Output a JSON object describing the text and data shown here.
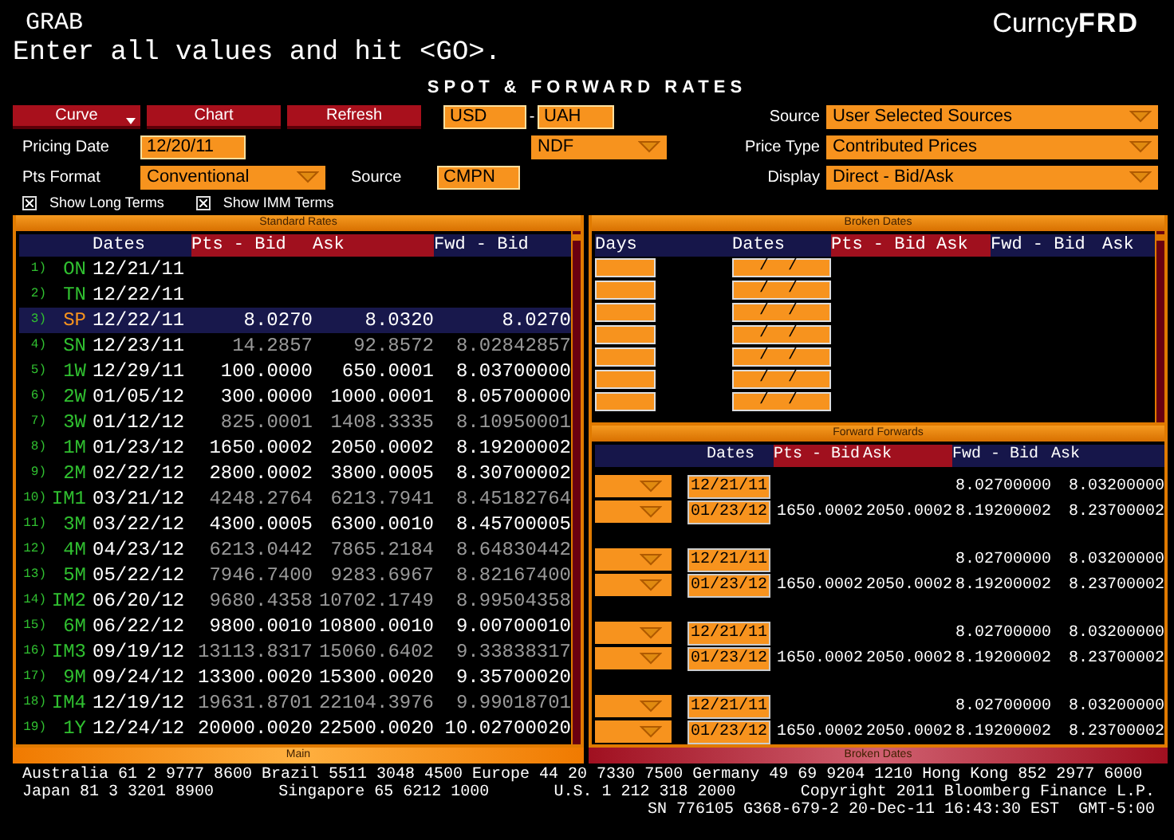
{
  "header": {
    "screen_name": "GRAB",
    "prompt": "Enter all values and hit <GO>.",
    "logo_prefix": "Curncy",
    "logo_suffix": "FRD"
  },
  "page_title": "SPOT & FORWARD RATES",
  "buttons": [
    {
      "label": "Curve",
      "has_menu": true
    },
    {
      "label": "Chart",
      "has_menu": false
    },
    {
      "label": "Refresh",
      "has_menu": false
    }
  ],
  "currency_pair": {
    "base": "USD",
    "separator": "-",
    "quote": "UAH"
  },
  "pricing_date": {
    "label": "Pricing Date",
    "value": "12/20/11"
  },
  "contract_type": {
    "value": "NDF"
  },
  "pts_format": {
    "label": "Pts Format",
    "value": "Conventional"
  },
  "rate_source": {
    "label": "Source",
    "value": "CMPN"
  },
  "settings": [
    {
      "label": "Source",
      "value": "User Selected Sources"
    },
    {
      "label": "Price Type",
      "value": "Contributed Prices"
    },
    {
      "label": "Display",
      "value": "Direct - Bid/Ask"
    }
  ],
  "options": [
    {
      "label": "Show Long Terms",
      "checked": true
    },
    {
      "label": "Show IMM Terms",
      "checked": true
    }
  ],
  "standard_rates": {
    "title": "Standard Rates",
    "columns": [
      {
        "label": "Dates",
        "kind": "dates"
      },
      {
        "label": "Pts - Bid",
        "kind": "points"
      },
      {
        "label": "Ask",
        "kind": "points"
      },
      {
        "label": "Fwd - Bid",
        "kind": "forward"
      }
    ],
    "rows": [
      {
        "number": "1)",
        "tenor": "ON",
        "date": "12/21/11",
        "selected": false
      },
      {
        "number": "2)",
        "tenor": "TN",
        "date": "12/22/11",
        "selected": false
      },
      {
        "number": "3)",
        "tenor": "SP",
        "date": "12/22/11",
        "pts_bid": "8.0270",
        "pts_ask": "8.0320",
        "fwd_bid": "8.0270",
        "selected": true,
        "interpolated": false
      },
      {
        "number": "4)",
        "tenor": "SN",
        "date": "12/23/11",
        "pts_bid": "14.2857",
        "pts_ask": "92.8572",
        "fwd_bid": "8.02842857",
        "selected": false,
        "interpolated": true
      },
      {
        "number": "5)",
        "tenor": "1W",
        "date": "12/29/11",
        "pts_bid": "100.0000",
        "pts_ask": "650.0001",
        "fwd_bid": "8.03700000",
        "selected": false,
        "interpolated": false
      },
      {
        "number": "6)",
        "tenor": "2W",
        "date": "01/05/12",
        "pts_bid": "300.0000",
        "pts_ask": "1000.0001",
        "fwd_bid": "8.05700000",
        "selected": false,
        "interpolated": false
      },
      {
        "number": "7)",
        "tenor": "3W",
        "date": "01/12/12",
        "pts_bid": "825.0001",
        "pts_ask": "1408.3335",
        "fwd_bid": "8.10950001",
        "selected": false,
        "interpolated": true
      },
      {
        "number": "8)",
        "tenor": "1M",
        "date": "01/23/12",
        "pts_bid": "1650.0002",
        "pts_ask": "2050.0002",
        "fwd_bid": "8.19200002",
        "selected": false,
        "interpolated": false
      },
      {
        "number": "9)",
        "tenor": "2M",
        "date": "02/22/12",
        "pts_bid": "2800.0002",
        "pts_ask": "3800.0005",
        "fwd_bid": "8.30700002",
        "selected": false,
        "interpolated": false
      },
      {
        "number": "10)",
        "tenor": "IM1",
        "date": "03/21/12",
        "pts_bid": "4248.2764",
        "pts_ask": "6213.7941",
        "fwd_bid": "8.45182764",
        "selected": false,
        "interpolated": true
      },
      {
        "number": "11)",
        "tenor": "3M",
        "date": "03/22/12",
        "pts_bid": "4300.0005",
        "pts_ask": "6300.0010",
        "fwd_bid": "8.45700005",
        "selected": false,
        "interpolated": false
      },
      {
        "number": "12)",
        "tenor": "4M",
        "date": "04/23/12",
        "pts_bid": "6213.0442",
        "pts_ask": "7865.2184",
        "fwd_bid": "8.64830442",
        "selected": false,
        "interpolated": true
      },
      {
        "number": "13)",
        "tenor": "5M",
        "date": "05/22/12",
        "pts_bid": "7946.7400",
        "pts_ask": "9283.6967",
        "fwd_bid": "8.82167400",
        "selected": false,
        "interpolated": true
      },
      {
        "number": "14)",
        "tenor": "IM2",
        "date": "06/20/12",
        "pts_bid": "9680.4358",
        "pts_ask": "10702.1749",
        "fwd_bid": "8.99504358",
        "selected": false,
        "interpolated": true
      },
      {
        "number": "15)",
        "tenor": "6M",
        "date": "06/22/12",
        "pts_bid": "9800.0010",
        "pts_ask": "10800.0010",
        "fwd_bid": "9.00700010",
        "selected": false,
        "interpolated": false
      },
      {
        "number": "16)",
        "tenor": "IM3",
        "date": "09/19/12",
        "pts_bid": "13113.8317",
        "pts_ask": "15060.6402",
        "fwd_bid": "9.33838317",
        "selected": false,
        "interpolated": true
      },
      {
        "number": "17)",
        "tenor": "9M",
        "date": "09/24/12",
        "pts_bid": "13300.0020",
        "pts_ask": "15300.0020",
        "fwd_bid": "9.35700020",
        "selected": false,
        "interpolated": false
      },
      {
        "number": "18)",
        "tenor": "IM4",
        "date": "12/19/12",
        "pts_bid": "19631.8701",
        "pts_ask": "22104.3976",
        "fwd_bid": "9.99018701",
        "selected": false,
        "interpolated": true
      },
      {
        "number": "19)",
        "tenor": "1Y",
        "date": "12/24/12",
        "pts_bid": "20000.0020",
        "pts_ask": "22500.0020",
        "fwd_bid": "10.02700020",
        "selected": false,
        "interpolated": false
      }
    ]
  },
  "broken_dates": {
    "title": "Broken Dates",
    "columns": [
      {
        "label": "Days",
        "kind": "dates"
      },
      {
        "label": "Dates",
        "kind": "dates"
      },
      {
        "label": "Pts - Bid",
        "kind": "points"
      },
      {
        "label": "Ask",
        "kind": "points"
      },
      {
        "label": "Fwd - Bid",
        "kind": "forward"
      },
      {
        "label": "Ask",
        "kind": "forward"
      }
    ],
    "rows": [
      {
        "date": "/  /"
      },
      {
        "date": "/  /"
      },
      {
        "date": "/  /"
      },
      {
        "date": "/  /"
      },
      {
        "date": "/  /"
      },
      {
        "date": "/  /"
      },
      {
        "date": "/  /"
      }
    ]
  },
  "forward_forwards": {
    "title": "Forward Forwards",
    "columns": [
      {
        "label": "Dates",
        "kind": "dates"
      },
      {
        "label": "Pts - Bid",
        "kind": "points"
      },
      {
        "label": "Ask",
        "kind": "points"
      },
      {
        "label": "Fwd - Bid",
        "kind": "forward"
      },
      {
        "label": "Ask",
        "kind": "forward"
      }
    ],
    "pairs": [
      {
        "legs": [
          {
            "date": "12/21/11",
            "fwd_bid": "8.02700000",
            "fwd_ask": "8.03200000"
          },
          {
            "date": "01/23/12",
            "pts_bid": "1650.0002",
            "pts_ask": "2050.0002",
            "fwd_bid": "8.19200002",
            "fwd_ask": "8.23700002"
          }
        ]
      },
      {
        "legs": [
          {
            "date": "12/21/11",
            "fwd_bid": "8.02700000",
            "fwd_ask": "8.03200000"
          },
          {
            "date": "01/23/12",
            "pts_bid": "1650.0002",
            "pts_ask": "2050.0002",
            "fwd_bid": "8.19200002",
            "fwd_ask": "8.23700002"
          }
        ]
      },
      {
        "legs": [
          {
            "date": "12/21/11",
            "fwd_bid": "8.02700000",
            "fwd_ask": "8.03200000"
          },
          {
            "date": "01/23/12",
            "pts_bid": "1650.0002",
            "pts_ask": "2050.0002",
            "fwd_bid": "8.19200002",
            "fwd_ask": "8.23700002"
          }
        ]
      },
      {
        "legs": [
          {
            "date": "12/21/11",
            "fwd_bid": "8.02700000",
            "fwd_ask": "8.03200000"
          },
          {
            "date": "01/23/12",
            "pts_bid": "1650.0002",
            "pts_ask": "2050.0002",
            "fwd_bid": "8.19200002",
            "fwd_ask": "8.23700002"
          }
        ]
      }
    ]
  },
  "tabs": [
    {
      "label": "Main",
      "selected": true
    },
    {
      "label": "Broken Dates",
      "selected": false
    }
  ],
  "footer": {
    "contacts": "Australia 61 2 9777 8600 Brazil 5511 3048 4500 Europe 44 20 7330 7500 Germany 49 69 9204 1210 Hong Kong 852 2977 6000",
    "offices": [
      "Japan 81 3 3201 8900",
      "Singapore 65 6212 1000",
      "U.S. 1 212 318 2000",
      "Copyright 2011 Bloomberg Finance L.P."
    ],
    "session": "SN 776105 G368-679-2 20-Dec-11 16:43:30 EST  GMT-5:00"
  }
}
